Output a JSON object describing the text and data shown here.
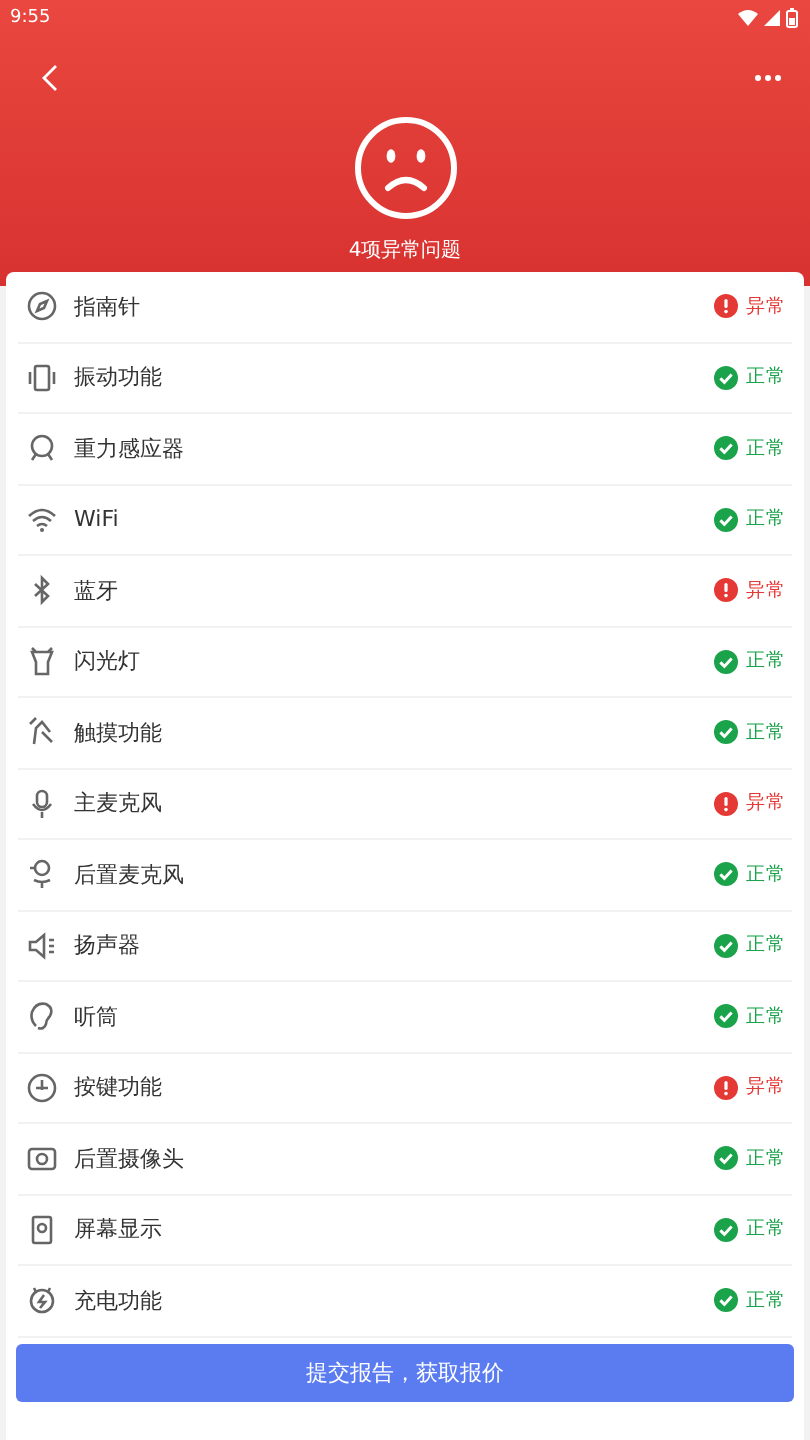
{
  "status_bar": {
    "time": "9:55"
  },
  "header": {
    "summary": "4项异常问题"
  },
  "checks": [
    {
      "label": "指南针",
      "abnormal": true,
      "status_text": "异常"
    },
    {
      "label": "振动功能",
      "abnormal": false,
      "status_text": "正常"
    },
    {
      "label": "重力感应器",
      "abnormal": false,
      "status_text": "正常"
    },
    {
      "label": "WiFi",
      "abnormal": false,
      "status_text": "正常"
    },
    {
      "label": "蓝牙",
      "abnormal": true,
      "status_text": "异常"
    },
    {
      "label": "闪光灯",
      "abnormal": false,
      "status_text": "正常"
    },
    {
      "label": "触摸功能",
      "abnormal": false,
      "status_text": "正常"
    },
    {
      "label": "主麦克风",
      "abnormal": true,
      "status_text": "异常"
    },
    {
      "label": "后置麦克风",
      "abnormal": false,
      "status_text": "正常"
    },
    {
      "label": "扬声器",
      "abnormal": false,
      "status_text": "正常"
    },
    {
      "label": "听筒",
      "abnormal": false,
      "status_text": "正常"
    },
    {
      "label": "按键功能",
      "abnormal": true,
      "status_text": "异常"
    },
    {
      "label": "后置摄像头",
      "abnormal": false,
      "status_text": "正常"
    },
    {
      "label": "屏幕显示",
      "abnormal": false,
      "status_text": "正常"
    },
    {
      "label": "充电功能",
      "abnormal": false,
      "status_text": "正常"
    }
  ],
  "submit_button": "提交报告，获取报价"
}
